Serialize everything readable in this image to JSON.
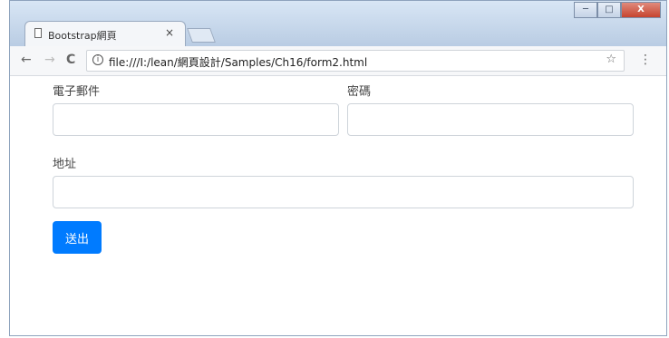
{
  "browser": {
    "tab_title": "Bootstrap網頁",
    "tab_close": "×",
    "url": "file:///I:/lean/網頁設計/Samples/Ch16/form2.html",
    "back_icon": "←",
    "forward_icon": "→",
    "reload_icon": "C",
    "info_icon": "i",
    "star_icon": "☆",
    "menu_icon": "⋮",
    "window_controls": [
      "─",
      "□",
      "X"
    ]
  },
  "form": {
    "email_label": "電子郵件",
    "password_label": "密碼",
    "address_label": "地址",
    "email_value": "",
    "password_value": "",
    "address_value": "",
    "submit_label": "送出",
    "accent_color": "#007bff"
  }
}
